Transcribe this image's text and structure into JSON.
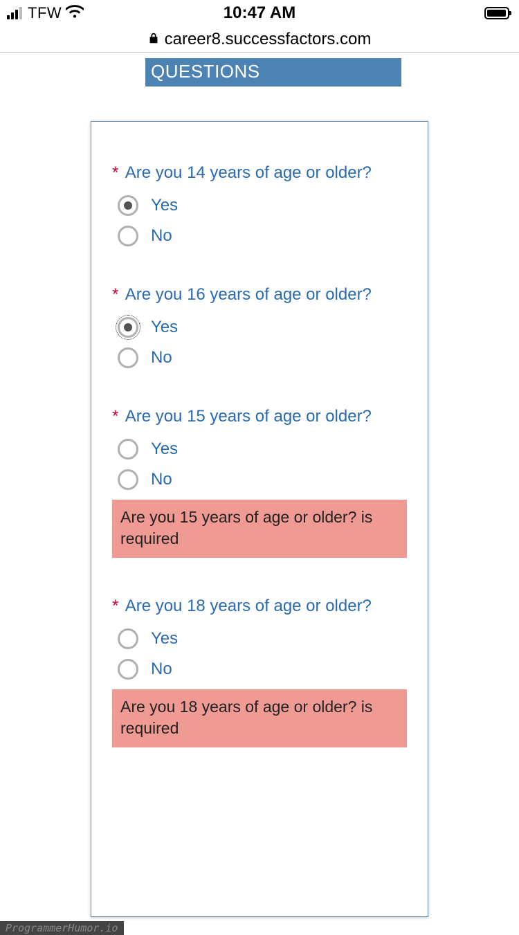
{
  "status": {
    "carrier": "TFW",
    "time": "10:47 AM"
  },
  "url": "career8.successfactors.com",
  "section_title": "QUESTIONS",
  "questions": [
    {
      "label": "Are you 14 years of age or older?",
      "yes": "Yes",
      "no": "No",
      "selected": "yes",
      "focused": false,
      "error": null
    },
    {
      "label": "Are you 16 years of age or older?",
      "yes": "Yes",
      "no": "No",
      "selected": "yes",
      "focused": true,
      "error": null
    },
    {
      "label": "Are you 15 years of age or older?",
      "yes": "Yes",
      "no": "No",
      "selected": null,
      "focused": false,
      "error": "Are you 15 years of age or older? is required"
    },
    {
      "label": "Are you 18 years of age or older?",
      "yes": "Yes",
      "no": "No",
      "selected": null,
      "focused": false,
      "error": "Are you 18 years of age or older? is required"
    }
  ],
  "watermark": "ProgrammerHumor.io"
}
